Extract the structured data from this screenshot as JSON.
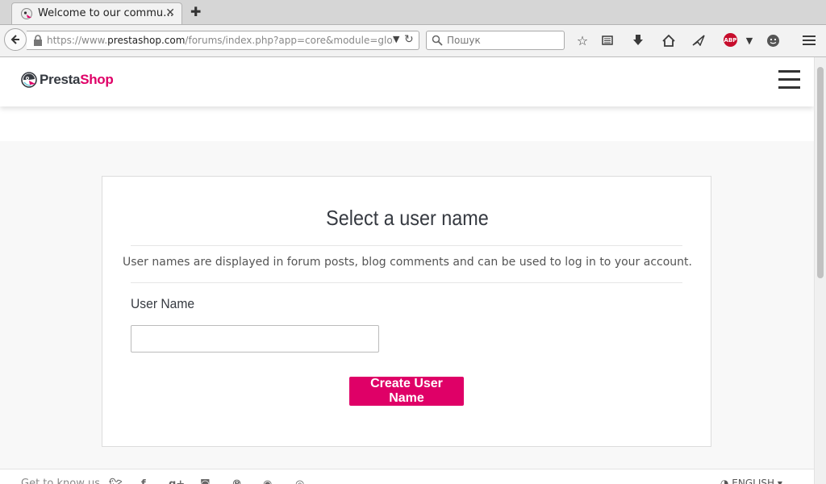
{
  "browser": {
    "tab_title": "Welcome to our commu…",
    "tab_close": "✕",
    "new_tab": "✚",
    "url_prefix": "https://www.",
    "url_domain": "prestashop.com",
    "url_path": "/forums/index.php?app=core&module=global&",
    "search_placeholder": "Пошук",
    "abp_label": "ABP"
  },
  "site": {
    "logo_part1": "Presta",
    "logo_part2": "Shop"
  },
  "card": {
    "title": "Select a user name",
    "description": "User names are displayed in forum posts, blog comments and can be used to log in to your account.",
    "field_label": "User Name",
    "field_value": "",
    "button_label": "Create User Name"
  },
  "footer": {
    "get_to_know": "Get to know us",
    "language": "ENGLISH"
  },
  "colors": {
    "brand": "#df0067",
    "logo_dark": "#363a41"
  }
}
